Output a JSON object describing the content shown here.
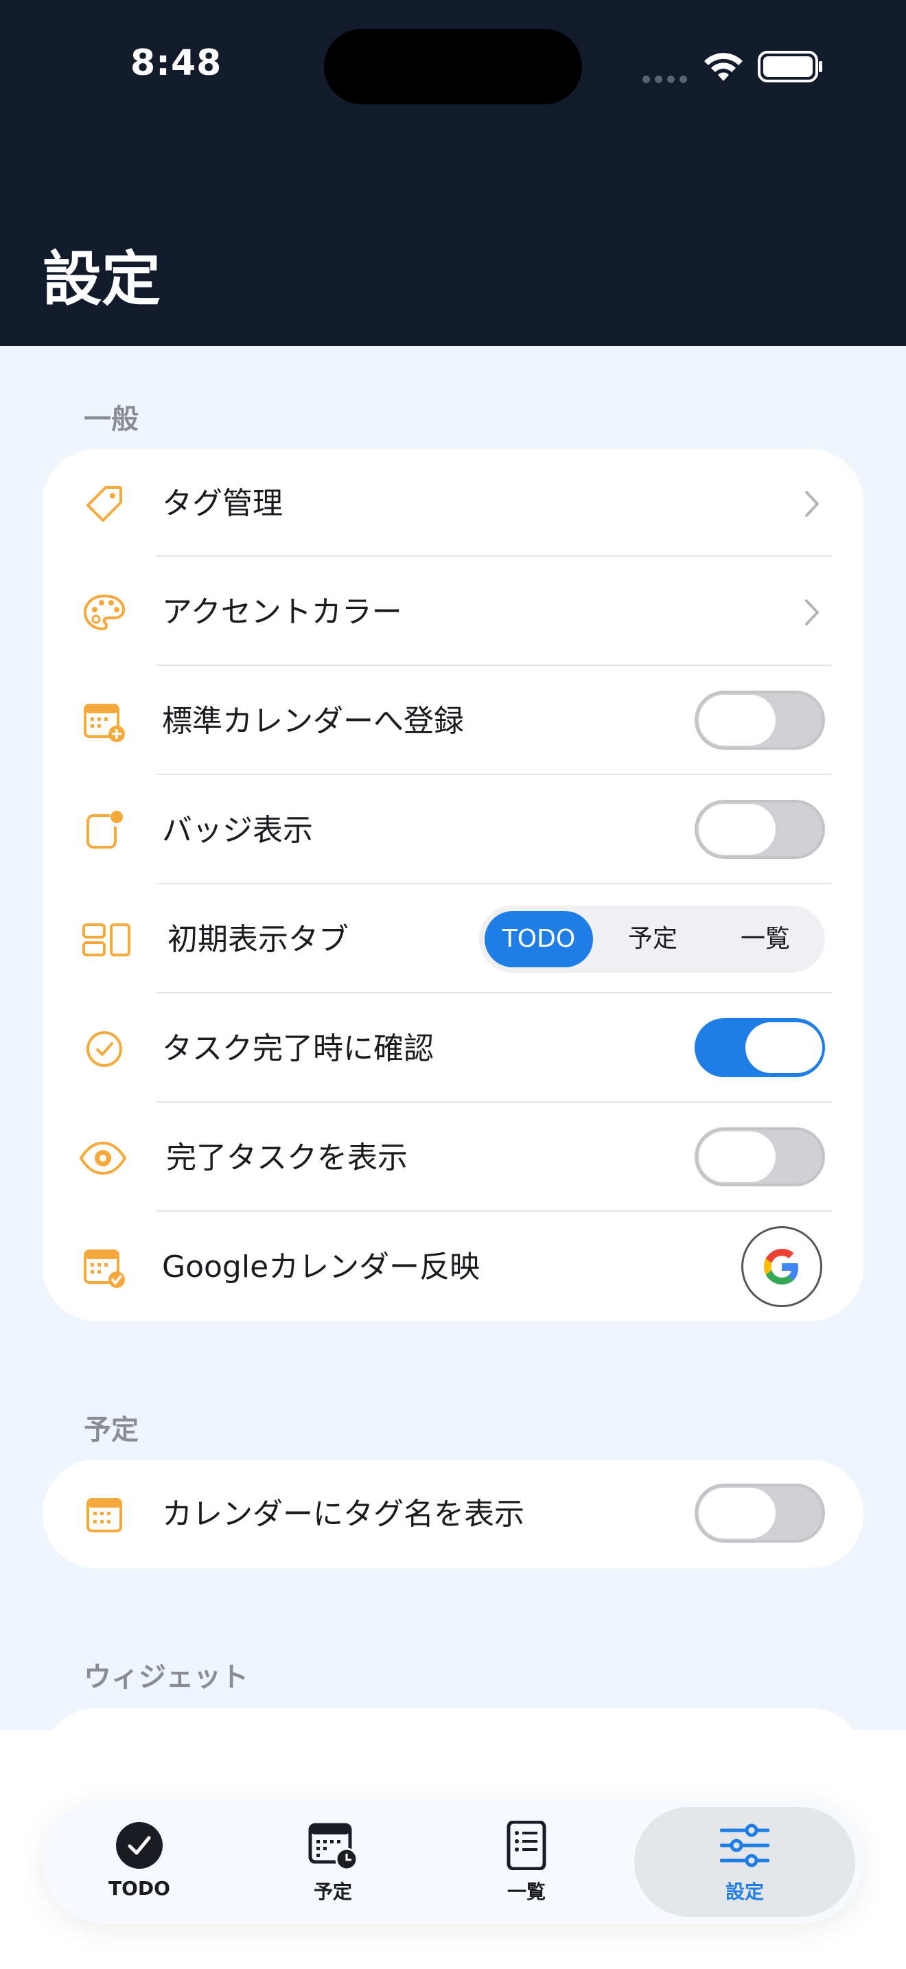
{
  "status_bar": {
    "time": "8:48"
  },
  "page_title": "設定",
  "colors": {
    "accent": "#1f7ee6",
    "icon": "#f6a93b",
    "header": "#111b2b"
  },
  "sections": [
    {
      "label": "一般",
      "rows": [
        {
          "label": "タグ管理",
          "icon": "tag-icon",
          "control": "chevron"
        },
        {
          "label": "アクセントカラー",
          "icon": "palette-icon",
          "control": "chevron"
        },
        {
          "label": "標準カレンダーへ登録",
          "icon": "calendar-add-icon",
          "control": "toggle",
          "on": false
        },
        {
          "label": "バッジ表示",
          "icon": "badge-icon",
          "control": "toggle",
          "on": false
        },
        {
          "label": "初期表示タブ",
          "icon": "layout-icon",
          "control": "segmented",
          "options": [
            "TODO",
            "予定",
            "一覧"
          ],
          "selected": "TODO"
        },
        {
          "label": "タスク完了時に確認",
          "icon": "check-circle-icon",
          "control": "toggle",
          "on": true
        },
        {
          "label": "完了タスクを表示",
          "icon": "eye-icon",
          "control": "toggle",
          "on": false
        },
        {
          "label": "Googleカレンダー反映",
          "icon": "calendar-check-icon",
          "control": "google-button"
        }
      ]
    },
    {
      "label": "予定",
      "rows": [
        {
          "label": "カレンダーにタグ名を表示",
          "icon": "calendar-icon",
          "control": "toggle",
          "on": false
        }
      ]
    },
    {
      "label": "ウィジェット",
      "rows": []
    }
  ],
  "tab_bar": {
    "items": [
      {
        "label": "TODO",
        "icon": "checkmark-circle-icon"
      },
      {
        "label": "予定",
        "icon": "calendar-clock-icon"
      },
      {
        "label": "一覧",
        "icon": "list-icon"
      },
      {
        "label": "設定",
        "icon": "sliders-icon"
      }
    ],
    "selected": "設定"
  }
}
